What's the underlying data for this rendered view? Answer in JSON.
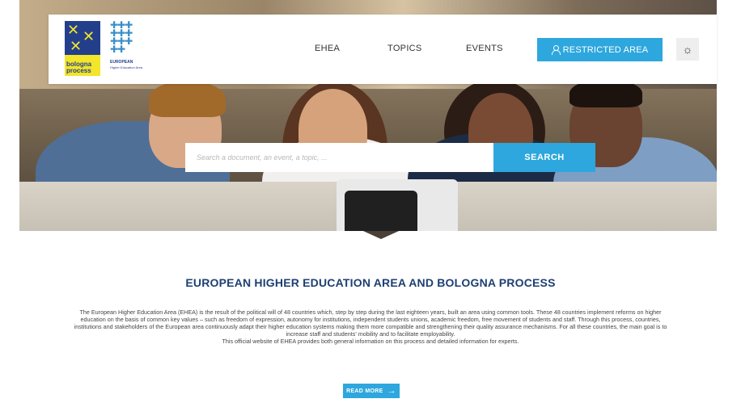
{
  "header": {
    "logo_bologna_text": "bologna process",
    "logo_ehea_line1": "EUROPEAN",
    "logo_ehea_line2": "Higher Education Area",
    "nav": [
      {
        "label": "EHEA"
      },
      {
        "label": "TOPICS"
      },
      {
        "label": "EVENTS"
      }
    ],
    "restricted_label": "RESTRICTED AREA",
    "theme_icon": "sun-icon"
  },
  "search": {
    "placeholder": "Search a document, an event, a topic, ...",
    "button_label": "SEARCH"
  },
  "main": {
    "title": "EUROPEAN HIGHER EDUCATION AREA AND BOLOGNA PROCESS",
    "paragraph1": "The European Higher Education Area (EHEA) is the result of the political will of 48 countries which, step by step during the last eighteen years, built an area using common tools. These 48 countries implement reforms on higher education on the basis of common key values – such as freedom of expression, autonomy for institutions, independent students unions, academic freedom, free movement of students and staff. Through this process, countries, institutions and stakeholders of the European area continuously adapt their higher education systems making them more compatible and strengthening their quality assurance mechanisms. For all these countries, the main goal is to increase staff and students' mobility and to facilitate employability.",
    "paragraph2": "This official website of EHEA provides both general information on this process and detailed information for experts.",
    "read_more_label": "READ MORE"
  },
  "colors": {
    "accent": "#2da7dd",
    "title": "#1d3f73"
  }
}
